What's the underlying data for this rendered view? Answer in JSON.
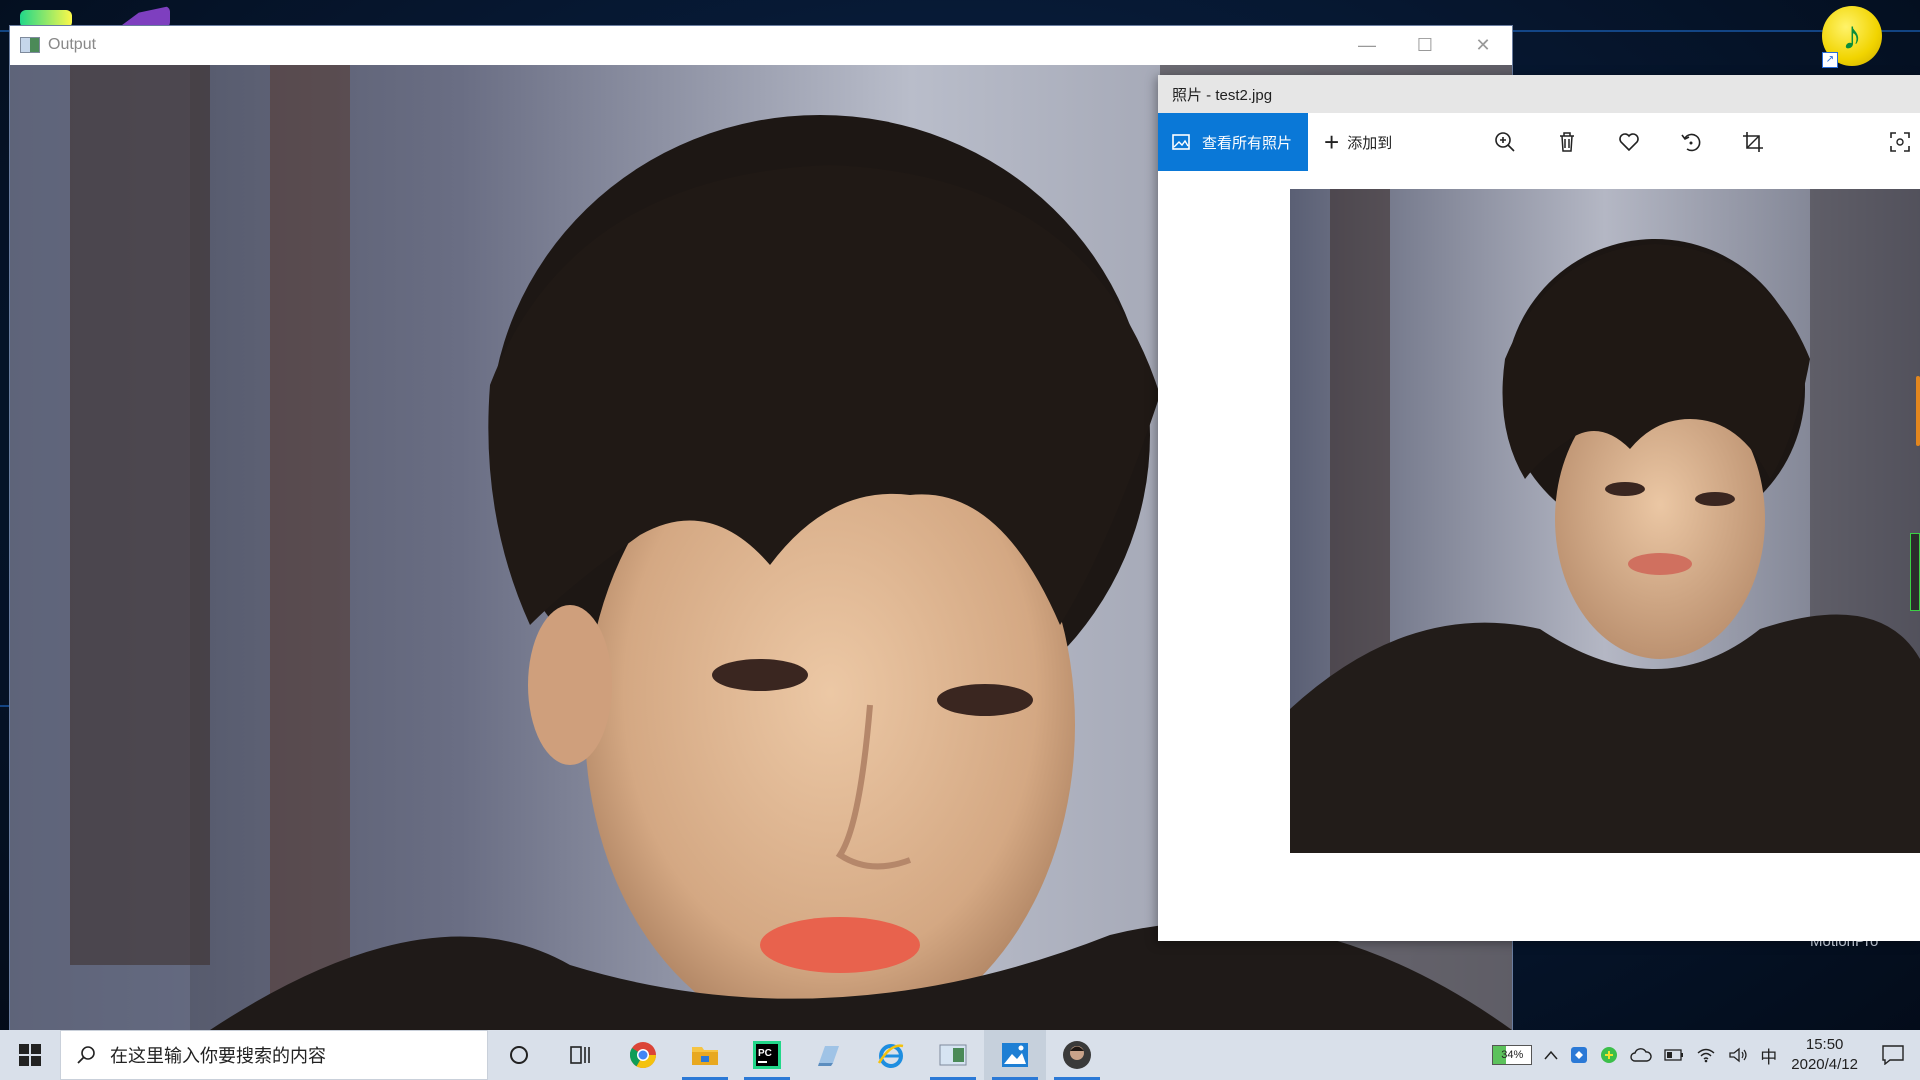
{
  "desktop": {
    "label_partial": "MotionPro"
  },
  "output_window": {
    "title": "Output",
    "controls": {
      "minimize": "—",
      "maximize": "☐",
      "close": "✕"
    }
  },
  "photos_window": {
    "title": "照片 - test2.jpg",
    "toolbar": {
      "view_all_label": "查看所有照片",
      "add_to_label": "添加到"
    }
  },
  "taskbar": {
    "search_placeholder": "在这里输入你要搜索的内容",
    "pinned": [
      "cortana-icon",
      "task-view-icon",
      "chrome-icon",
      "file-explorer-icon",
      "pycharm-icon",
      "app-icon",
      "ie-icon",
      "output-app-icon",
      "photos-icon",
      "avatar-app-icon"
    ]
  },
  "tray": {
    "battery_percent": "34%",
    "ime_label": "中",
    "time": "15:50",
    "date": "2020/4/12"
  },
  "colors": {
    "accent": "#0a78d7",
    "taskbar_bg": "#d9e0ea"
  }
}
